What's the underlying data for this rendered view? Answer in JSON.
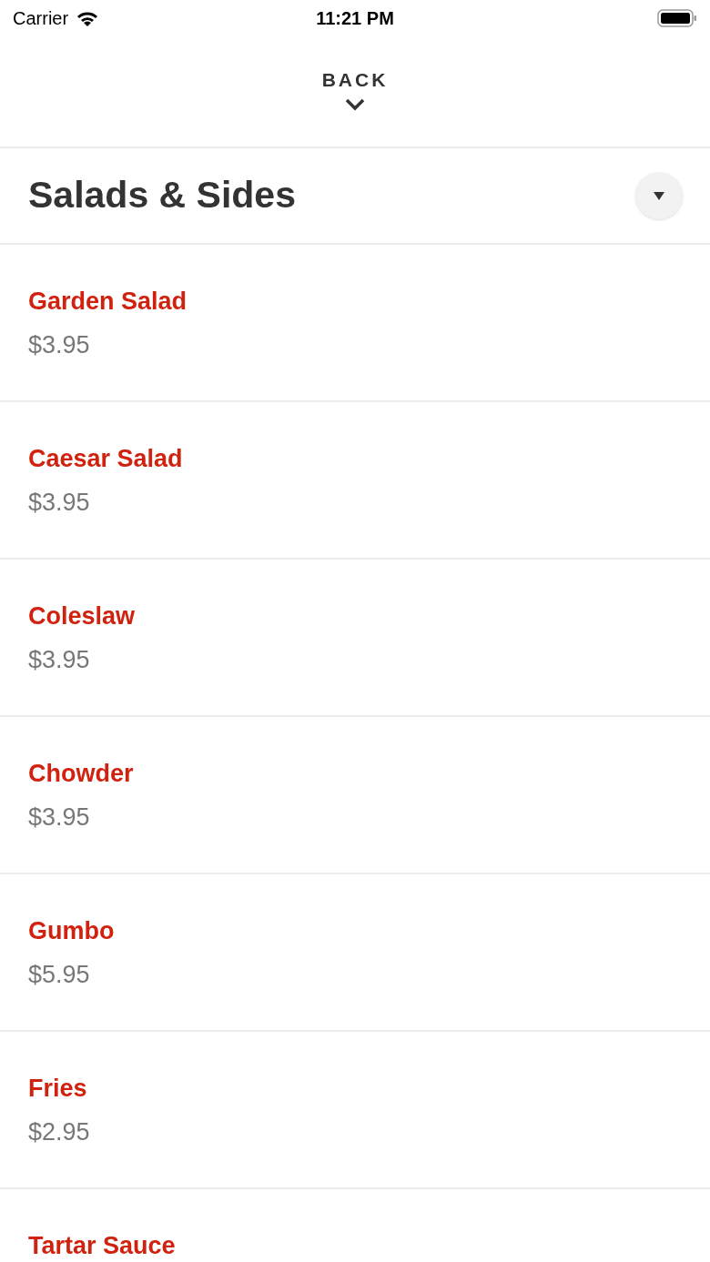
{
  "status_bar": {
    "carrier": "Carrier",
    "time": "11:21 PM"
  },
  "back": {
    "label": "BACK"
  },
  "section": {
    "title": "Salads & Sides"
  },
  "items": [
    {
      "name": "Garden Salad",
      "price": "$3.95"
    },
    {
      "name": "Caesar Salad",
      "price": "$3.95"
    },
    {
      "name": "Coleslaw",
      "price": "$3.95"
    },
    {
      "name": "Chowder",
      "price": "$3.95"
    },
    {
      "name": "Gumbo",
      "price": "$5.95"
    },
    {
      "name": "Fries",
      "price": "$2.95"
    },
    {
      "name": "Tartar Sauce"
    }
  ]
}
